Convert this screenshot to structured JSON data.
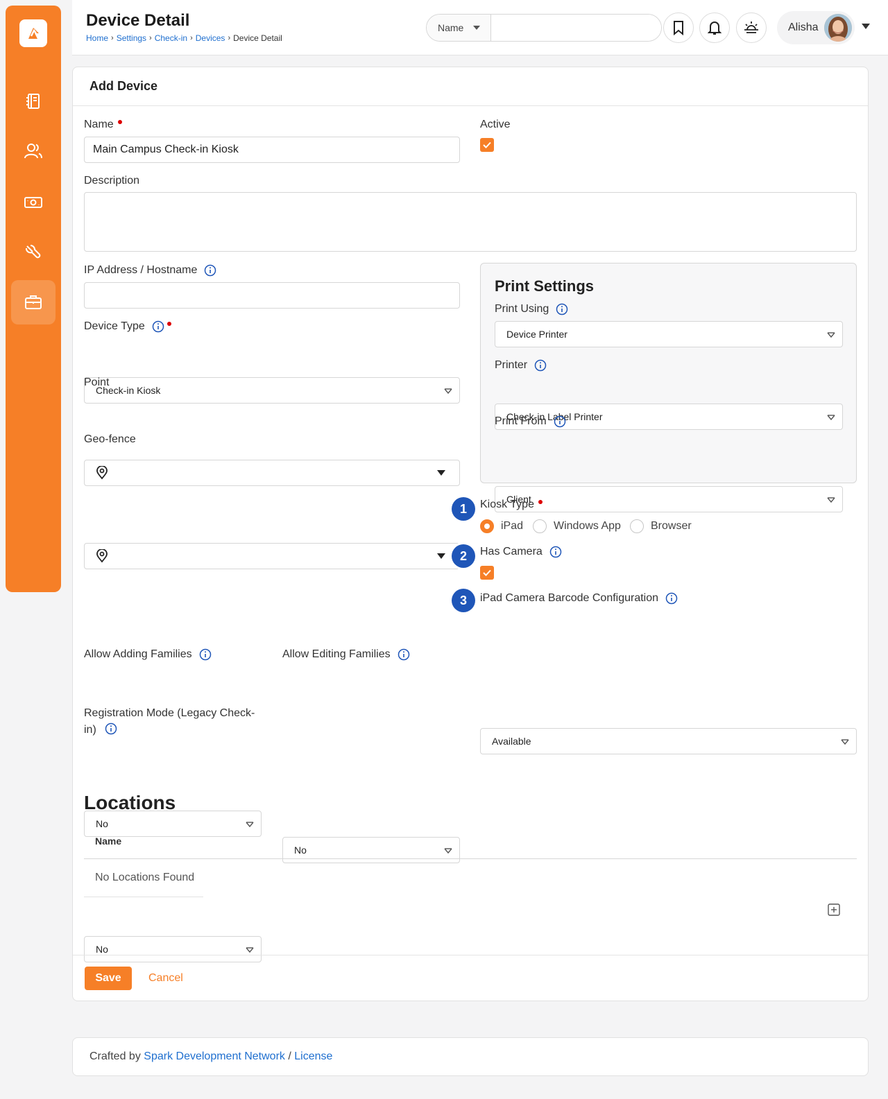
{
  "header": {
    "title": "Device Detail",
    "breadcrumb": [
      "Home",
      "Settings",
      "Check-in",
      "Devices"
    ],
    "breadcrumb_current": "Device Detail",
    "search_type": "Name",
    "search_value": "",
    "user_name": "Alisha"
  },
  "card": {
    "title": "Add Device"
  },
  "form": {
    "name_label": "Name",
    "name_value": "Main Campus Check-in Kiosk",
    "active_label": "Active",
    "description_label": "Description",
    "description_value": "",
    "ip_label": "IP Address / Hostname",
    "ip_value": "",
    "device_type_label": "Device Type",
    "device_type_value": "Check-in Kiosk",
    "point_label": "Point",
    "geofence_label": "Geo-fence",
    "allow_adding_label": "Allow Adding Families",
    "allow_adding_value": "No",
    "allow_editing_label": "Allow Editing Families",
    "allow_editing_value": "No",
    "registration_label": "Registration Mode (Legacy Check-in)",
    "registration_value": "No"
  },
  "print_settings": {
    "title": "Print Settings",
    "print_using_label": "Print Using",
    "print_using_value": "Device Printer",
    "printer_label": "Printer",
    "printer_value": "Check-in Label Printer",
    "print_from_label": "Print From",
    "print_from_value": "Client"
  },
  "kiosk": {
    "badge1": "1",
    "badge2": "2",
    "badge3": "3",
    "kiosk_type_label": "Kiosk Type",
    "options": [
      "iPad",
      "Windows App",
      "Browser"
    ],
    "selected": "iPad",
    "has_camera_label": "Has Camera",
    "barcode_label": "iPad Camera Barcode Configuration",
    "barcode_value": "Available"
  },
  "locations": {
    "title": "Locations",
    "column_name": "Name",
    "empty_text": "No Locations Found"
  },
  "actions": {
    "save": "Save",
    "cancel": "Cancel"
  },
  "footer": {
    "crafted_by": "Crafted by",
    "org_link": "Spark Development Network",
    "separator": "/",
    "license_link": "License"
  },
  "colors": {
    "accent": "#f67f27",
    "link": "#1f6fcf",
    "badge": "#1f56b8"
  }
}
